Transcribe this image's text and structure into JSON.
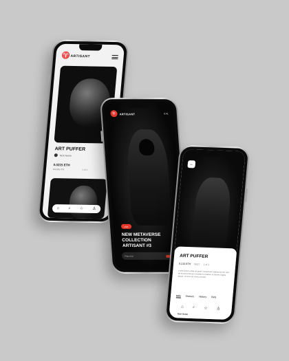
{
  "brand": {
    "name": "ARTISANT",
    "accent": "#e53a2b"
  },
  "screen1": {
    "title": "ART PUFFER",
    "owner": "Nick Name",
    "price": "0.0215 ETH",
    "stat_left": "Royalty 5%",
    "stat_mid": "1 of 1",
    "likes": "8",
    "tab_icons": [
      "home-icon",
      "search-icon",
      "star-icon",
      "profile-icon"
    ]
  },
  "screen2": {
    "time": "9:41",
    "badge": "LIVE",
    "title": "NEW METAVERSE COLLECTION ARTISANT #3",
    "bid_label": "Place bid"
  },
  "screen3": {
    "title": "ART PUFFER",
    "price": "0.215 ETH",
    "stat_a": "$327",
    "stat_b": "1 of 1",
    "description": "Lorem ipsum dolor sit amet, consectetur adipiscing elit, sed do eiusmod tempor incididunt ut labore et dolore magna aliqua. Ut enim ad minim veniam.",
    "tabs": [
      "Info",
      "Owners",
      "History",
      "Bids"
    ],
    "owner": "Nick Name"
  }
}
